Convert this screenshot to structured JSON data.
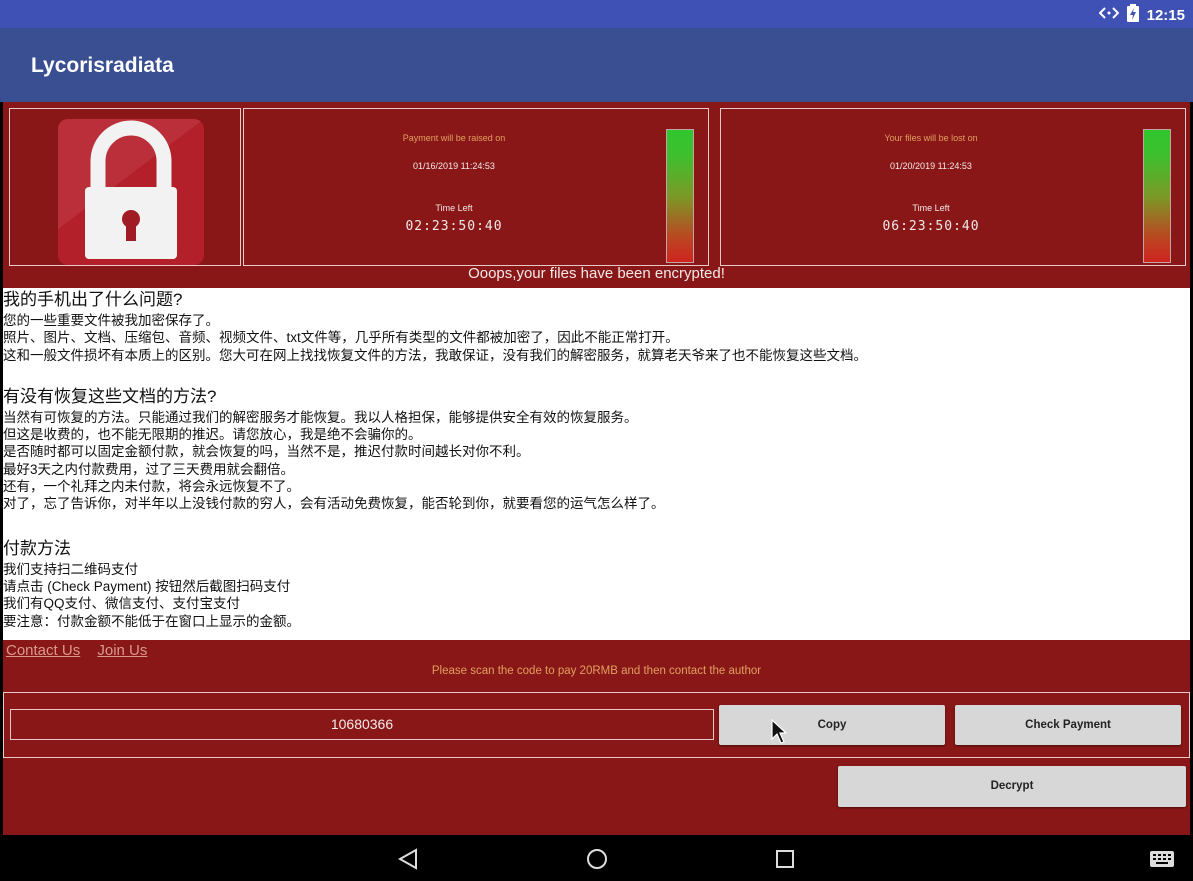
{
  "status_bar": {
    "time": "12:15"
  },
  "app": {
    "title": "Lycorisradiata"
  },
  "timer1": {
    "label": "Payment will be raised on",
    "date": "01/16/2019 11:24:53",
    "time_left_label": "Time Left",
    "countdown": "02:23:50:40"
  },
  "timer2": {
    "label": "Your files will be lost on",
    "date": "01/20/2019 11:24:53",
    "time_left_label": "Time Left",
    "countdown": "06:23:50:40"
  },
  "banner": "Ooops,your files have been encrypted!",
  "sections": {
    "s1": {
      "heading": "我的手机出了什么问题?",
      "lines": [
        "您的一些重要文件被我加密保存了。",
        "照片、图片、文档、压缩包、音频、视频文件、txt文件等，几乎所有类型的文件都被加密了，因此不能正常打开。",
        "这和一般文件损坏有本质上的区别。您大可在网上找找恢复文件的方法，我敢保证，没有我们的解密服务，就算老天爷来了也不能恢复这些文档。"
      ]
    },
    "s2": {
      "heading": "有没有恢复这些文档的方法?",
      "lines": [
        "当然有可恢复的方法。只能通过我们的解密服务才能恢复。我以人格担保，能够提供安全有效的恢复服务。",
        "但这是收费的，也不能无限期的推迟。请您放心，我是绝不会骗你的。",
        "是否随时都可以固定金额付款，就会恢复的吗，当然不是，推迟付款时间越长对你不利。",
        "最好3天之内付款费用，过了三天费用就会翻倍。",
        "还有，一个礼拜之内未付款，将会永远恢复不了。",
        "对了，忘了告诉你，对半年以上没钱付款的穷人，会有活动免费恢复，能否轮到你，就要看您的运气怎么样了。"
      ]
    },
    "s3": {
      "heading": "付款方法",
      "lines": [
        "我们支持扫二维码支付",
        "请点击 (Check Payment) 按钮然后截图扫码支付",
        "我们有QQ支付、微信支付、支付宝支付",
        "要注意：付款金额不能低于在窗口上显示的金额。"
      ]
    }
  },
  "footer": {
    "contact_us": "Contact Us",
    "join_us": "Join Us",
    "scan_message": "Please scan the code to pay 20RMB and then contact the author",
    "id_value": "10680366",
    "copy_label": "Copy",
    "check_payment_label": "Check Payment",
    "decrypt_label": "Decrypt"
  },
  "colors": {
    "accent_red": "#8a1717",
    "appbar": "#3a4f92",
    "statusbar": "#3f51b5"
  },
  "icons": [
    "data-sync-icon",
    "battery-icon",
    "lock-icon",
    "back-icon",
    "home-icon",
    "recents-icon",
    "keyboard-icon",
    "mouse-cursor-icon"
  ]
}
